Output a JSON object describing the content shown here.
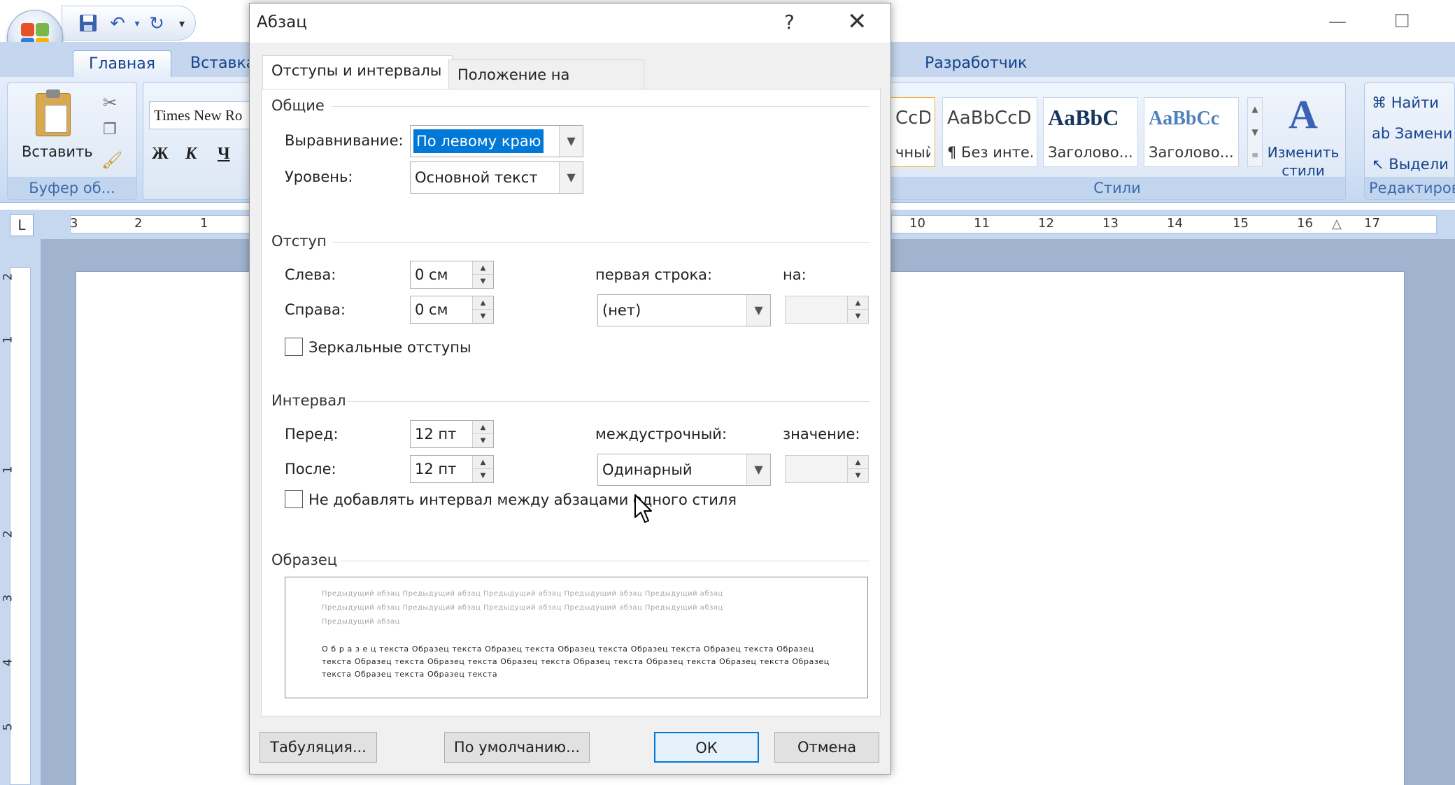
{
  "word": {
    "tabs": [
      "Главная",
      "Вставка",
      "Разработчик"
    ],
    "clipboard": {
      "paste_label": "Вставить",
      "group_label": "Буфер об..."
    },
    "font": {
      "name": "Times New Ro",
      "bold": "Ж",
      "italic": "К",
      "underline": "Ч"
    },
    "styles": {
      "items": [
        {
          "sample": "CcDc",
          "name": "чный"
        },
        {
          "sample": "AaBbCcDc",
          "name": "¶ Без инте..."
        },
        {
          "sample": "AaBbC",
          "name": "Заголово..."
        },
        {
          "sample": "AaBbCc",
          "name": "Заголово..."
        }
      ],
      "change_label": "Изменить стили",
      "group_label": "Стили"
    },
    "editing": {
      "find": "Найти",
      "replace": "Замени",
      "select": "Выдели",
      "group_label": "Редактиров"
    },
    "ruler_h_left": [
      "3",
      "2",
      "1"
    ],
    "ruler_h_right": [
      "10",
      "11",
      "12",
      "13",
      "14",
      "15",
      "16",
      "17"
    ],
    "ruler_v": [
      "2",
      "1",
      "1",
      "2",
      "3",
      "4",
      "5"
    ],
    "ruler_corner": "L"
  },
  "dialog": {
    "title": "Абзац",
    "help": "?",
    "close": "✕",
    "tabs": {
      "indents": "Отступы и интервалы",
      "position": "Положение на странице"
    },
    "general": {
      "title": "Общие",
      "alignment_label": "Выравнивание:",
      "alignment_value": "По левому краю",
      "level_label": "Уровень:",
      "level_value": "Основной текст"
    },
    "indent": {
      "title": "Отступ",
      "left_label": "Слева:",
      "left_value": "0 см",
      "right_label": "Справа:",
      "right_value": "0 см",
      "first_line_label": "первая строка:",
      "first_line_value": "(нет)",
      "by_label": "на:",
      "by_value": "",
      "mirror_label": "Зеркальные отступы"
    },
    "spacing": {
      "title": "Интервал",
      "before_label": "Перед:",
      "before_value": "12 пт",
      "after_label": "После:",
      "after_value": "12 пт",
      "line_label": "междустрочный:",
      "line_value": "Одинарный",
      "at_label": "значение:",
      "at_value": "",
      "no_space_label": "Не добавлять интервал между абзацами одного стиля"
    },
    "preview": {
      "title": "Образец",
      "prev_line1": "Предыдущий абзац Предыдущий абзац Предыдущий абзац Предыдущий абзац Предыдущий абзац",
      "prev_line2": "Предыдущий абзац Предыдущий абзац Предыдущий абзац Предыдущий абзац Предыдущий абзац",
      "prev_line3": "Предыдущий абзац",
      "sample_line1": "О б р а з е ц  текста Образец текста Образец текста Образец текста Образец текста Образец текста Образец",
      "sample_line2": "текста Образец текста Образец текста Образец текста Образец текста Образец текста Образец текста Образец",
      "sample_line3": "текста Образец текста Образец текста"
    },
    "buttons": {
      "tabs": "Табуляция...",
      "default": "По умолчанию...",
      "ok": "ОК",
      "cancel": "Отмена"
    }
  }
}
